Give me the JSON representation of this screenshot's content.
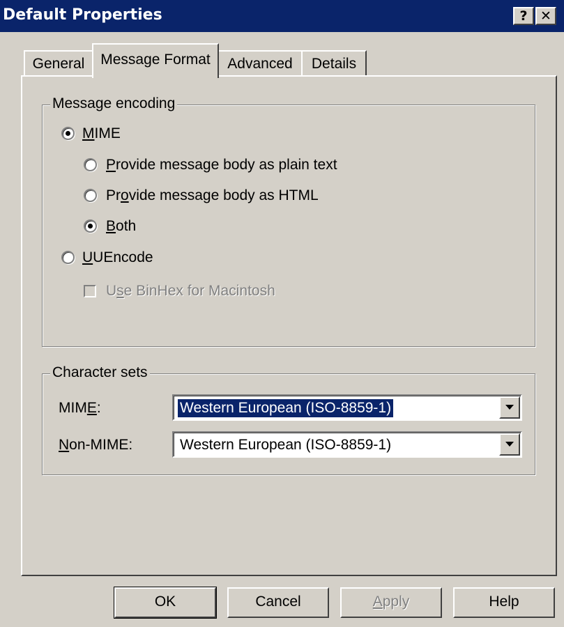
{
  "window": {
    "title": "Default Properties",
    "help_glyph": "?",
    "close_glyph": "✕"
  },
  "tabs": [
    {
      "label": "General",
      "active": false
    },
    {
      "label": "Message Format",
      "active": true
    },
    {
      "label": "Advanced",
      "active": false
    },
    {
      "label": "Details",
      "active": false
    }
  ],
  "encoding": {
    "legend": "Message encoding",
    "mime": {
      "label": "MIME",
      "mnemonic": "M",
      "checked": true
    },
    "plain_text": {
      "label": "Provide message body as plain text",
      "checked": false
    },
    "html": {
      "label": "Provide message body as HTML",
      "checked": false
    },
    "both": {
      "label": "Both",
      "checked": true
    },
    "uuencode": {
      "label": "UUEncode",
      "checked": false
    },
    "binhex": {
      "label": "Use BinHex for Macintosh",
      "checked": false,
      "enabled": false
    }
  },
  "charsets": {
    "legend": "Character sets",
    "mime_label": "MIME:",
    "mime_value": "Western European (ISO-8859-1)",
    "non_mime_label": "Non-MIME:",
    "non_mime_value": "Western European (ISO-8859-1)"
  },
  "buttons": {
    "ok": "OK",
    "cancel": "Cancel",
    "apply": "Apply",
    "help": "Help"
  },
  "colors": {
    "titlebar": "#0a246a",
    "face": "#d4d0c8",
    "selection": "#0a246a"
  }
}
